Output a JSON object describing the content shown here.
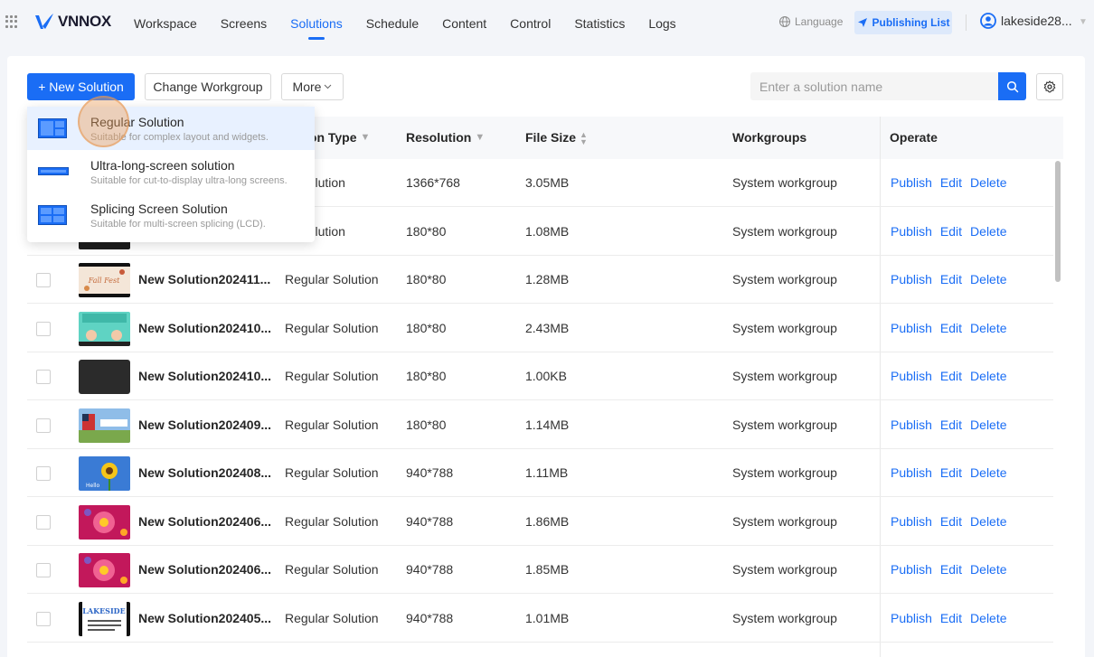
{
  "topbar": {
    "logo_text": "VNNOX",
    "nav": [
      "Workspace",
      "Screens",
      "Solutions",
      "Schedule",
      "Content",
      "Control",
      "Statistics",
      "Logs"
    ],
    "active_nav": "Solutions",
    "language_label": "Language",
    "publishing_list_label": "Publishing List",
    "username": "lakeside28..."
  },
  "toolbar": {
    "new_solution_label": "+ New Solution",
    "change_workgroup_label": "Change Workgroup",
    "more_label": "More",
    "search_placeholder": "Enter a solution name"
  },
  "dropdown": {
    "items": [
      {
        "title": "Regular Solution",
        "desc": "Suitable for complex layout and widgets."
      },
      {
        "title": "Ultra-long-screen solution",
        "desc": "Suitable for cut-to-display ultra-long screens."
      },
      {
        "title": "Splicing Screen Solution",
        "desc": "Suitable for multi-screen splicing (LCD)."
      }
    ]
  },
  "table": {
    "headers": {
      "type": "ion Type",
      "resolution": "Resolution",
      "file_size": "File Size",
      "workgroups": "Workgroups",
      "operate": "Operate"
    },
    "op_labels": {
      "publish": "Publish",
      "edit": "Edit",
      "delete": "Delete"
    },
    "rows": [
      {
        "name": "",
        "type": "ar Solution",
        "resolution": "1366*768",
        "size": "3.05MB",
        "workgroup": "System workgroup",
        "thumb": "hidden"
      },
      {
        "name": "",
        "type": "ar Solution",
        "resolution": "180*80",
        "size": "1.08MB",
        "workgroup": "System workgroup",
        "thumb": "dark"
      },
      {
        "name": "New Solution202411...",
        "type": "Regular Solution",
        "resolution": "180*80",
        "size": "1.28MB",
        "workgroup": "System workgroup",
        "thumb": "floral-text"
      },
      {
        "name": "New Solution202410...",
        "type": "Regular Solution",
        "resolution": "180*80",
        "size": "2.43MB",
        "workgroup": "System workgroup",
        "thumb": "teal-cartoon"
      },
      {
        "name": "New Solution202410...",
        "type": "Regular Solution",
        "resolution": "180*80",
        "size": "1.00KB",
        "workgroup": "System workgroup",
        "thumb": "black"
      },
      {
        "name": "New Solution202409...",
        "type": "Regular Solution",
        "resolution": "180*80",
        "size": "1.14MB",
        "workgroup": "System workgroup",
        "thumb": "flag-field"
      },
      {
        "name": "New Solution202408...",
        "type": "Regular Solution",
        "resolution": "940*788",
        "size": "1.11MB",
        "workgroup": "System workgroup",
        "thumb": "sunflower"
      },
      {
        "name": "New Solution202406...",
        "type": "Regular Solution",
        "resolution": "940*788",
        "size": "1.86MB",
        "workgroup": "System workgroup",
        "thumb": "pink-flower"
      },
      {
        "name": "New Solution202406...",
        "type": "Regular Solution",
        "resolution": "940*788",
        "size": "1.85MB",
        "workgroup": "System workgroup",
        "thumb": "pink-flower"
      },
      {
        "name": "New Solution202405...",
        "type": "Regular Solution",
        "resolution": "940*788",
        "size": "1.01MB",
        "workgroup": "System workgroup",
        "thumb": "lakeside-sign"
      }
    ]
  },
  "colors": {
    "accent": "#1a6df5",
    "header_bg": "#f7f8fa",
    "page_bg": "#f3f5f9"
  }
}
